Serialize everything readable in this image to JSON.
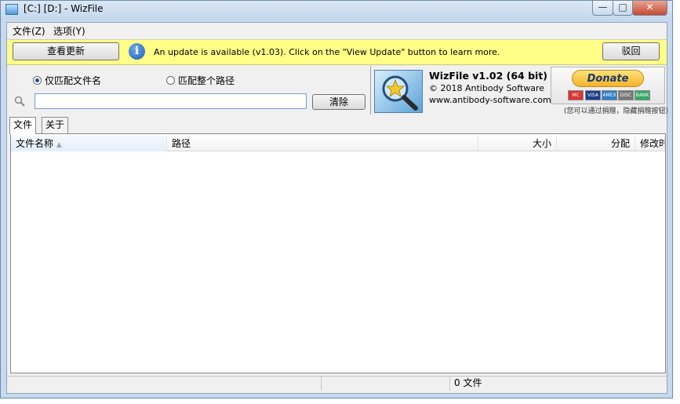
{
  "window": {
    "title": "[C:] [D:]  - WizFile",
    "min_glyph": "—",
    "max_glyph": "□",
    "close_glyph": "✕"
  },
  "menu": {
    "items": [
      {
        "label": "文件(Z)"
      },
      {
        "label": "选项(Y)"
      }
    ]
  },
  "update_bar": {
    "view_update_label": "查看更新",
    "message": "An update is available (v1.03). Click on the \"View Update\" button to learn more.",
    "dismiss_label": "驳回"
  },
  "search": {
    "radio_filename_label": "仅匹配文件名",
    "radio_fullpath_label": "匹配整个路径",
    "selected": "filename",
    "input_value": "",
    "clear_label": "清除"
  },
  "product": {
    "name": "WizFile v1.02 (64 bit)",
    "copyright": "© 2018 Antibody Software",
    "website": "www.antibody-software.com"
  },
  "donate": {
    "button_label": "Donate",
    "cards": [
      "MC",
      "VISA",
      "AMEX",
      "DISC",
      "BANK"
    ],
    "note": "(您可以通过捐赠，隐藏捐赠按钮)"
  },
  "tabs": [
    {
      "label": "文件",
      "active": true
    },
    {
      "label": "关于",
      "active": false
    }
  ],
  "list": {
    "columns": [
      {
        "label": "文件名称",
        "sorted": true
      },
      {
        "label": "路径"
      },
      {
        "label": "大小"
      },
      {
        "label": "分配"
      },
      {
        "label": "修改时"
      }
    ],
    "rows": []
  },
  "status": {
    "file_count": "0 文件"
  },
  "colors": {
    "update_bar": "#ffff88",
    "window_frame": "#c6d9ee",
    "donate_gold": "#f4b22a",
    "info_blue": "#1b5eb8"
  }
}
